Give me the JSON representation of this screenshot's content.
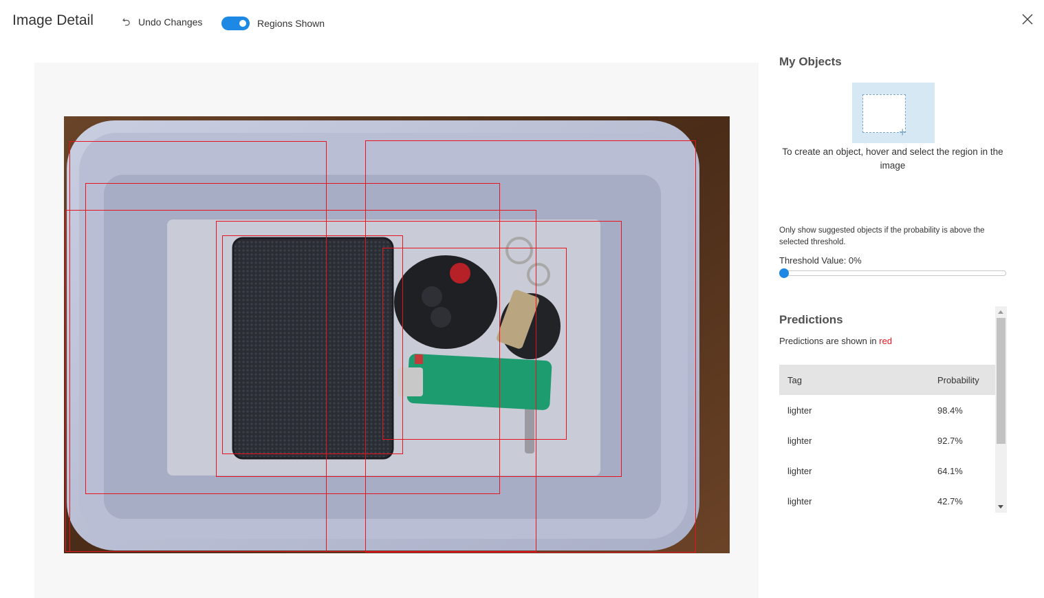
{
  "header": {
    "title": "Image Detail",
    "undo_label": "Undo Changes",
    "toggle_label": "Regions Shown",
    "toggle_on": true
  },
  "colors": {
    "accent": "#1e88e5",
    "region": "#e8141d",
    "canvas_bg": "#f7f7f7",
    "table_header_bg": "#e4e4e4"
  },
  "icons": {
    "undo": "undo-icon",
    "close": "close-icon",
    "add_region": "add-region-icon"
  },
  "objects": {
    "heading": "My Objects",
    "hint": "To create an object, hover and select the region in the image"
  },
  "threshold": {
    "note": "Only show suggested objects if the probability is above the selected threshold.",
    "label": "Threshold Value: 0%",
    "value": 0
  },
  "predictions": {
    "heading": "Predictions",
    "note_prefix": "Predictions are shown in",
    "note_color_word": "red",
    "columns": {
      "tag": "Tag",
      "probability": "Probability"
    },
    "rows": [
      {
        "tag": "lighter",
        "probability": "98.4%"
      },
      {
        "tag": "lighter",
        "probability": "92.7%"
      },
      {
        "tag": "lighter",
        "probability": "64.1%"
      },
      {
        "tag": "lighter",
        "probability": "42.7%"
      }
    ]
  },
  "image": {
    "region_count": 7
  }
}
